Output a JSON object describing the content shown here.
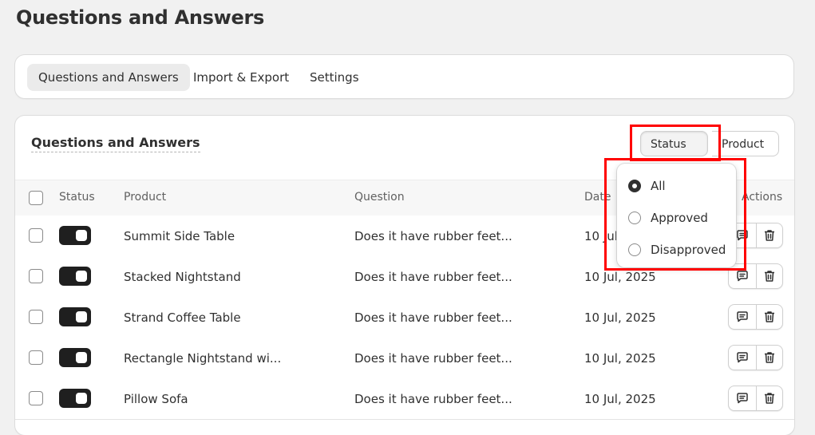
{
  "page": {
    "title": "Questions and Answers"
  },
  "tabs": [
    {
      "label": "Questions and Answers",
      "active": true
    },
    {
      "label": "Import & Export",
      "active": false
    },
    {
      "label": "Settings",
      "active": false
    }
  ],
  "card": {
    "title": "Questions and Answers",
    "filters": {
      "status_label": "Status",
      "product_label": "Product"
    }
  },
  "table": {
    "columns": [
      "Status",
      "Product",
      "Question",
      "Date",
      "Actions"
    ],
    "rows": [
      {
        "product": "Summit Side Table",
        "question": "Does it have rubber feet...",
        "date": "10 Jul, 2025",
        "enabled": true
      },
      {
        "product": "Stacked Nightstand",
        "question": "Does it have rubber feet...",
        "date": "10 Jul, 2025",
        "enabled": true
      },
      {
        "product": "Strand Coffee Table",
        "question": "Does it have rubber feet...",
        "date": "10 Jul, 2025",
        "enabled": true
      },
      {
        "product": "Rectangle Nightstand wi...",
        "question": "Does it have rubber feet...",
        "date": "10 Jul, 2025",
        "enabled": true
      },
      {
        "product": "Pillow Sofa",
        "question": "Does it have rubber feet...",
        "date": "10 Jul, 2025",
        "enabled": true
      }
    ],
    "first_row_date_visible": "10 Jul"
  },
  "status_dropdown": {
    "options": [
      {
        "label": "All",
        "selected": true
      },
      {
        "label": "Approved",
        "selected": false
      },
      {
        "label": "Disapproved",
        "selected": false
      }
    ]
  },
  "colors": {
    "highlight": "#ff0000",
    "toggle_on": "#1f1f1f",
    "background": "#f1f1f1"
  }
}
